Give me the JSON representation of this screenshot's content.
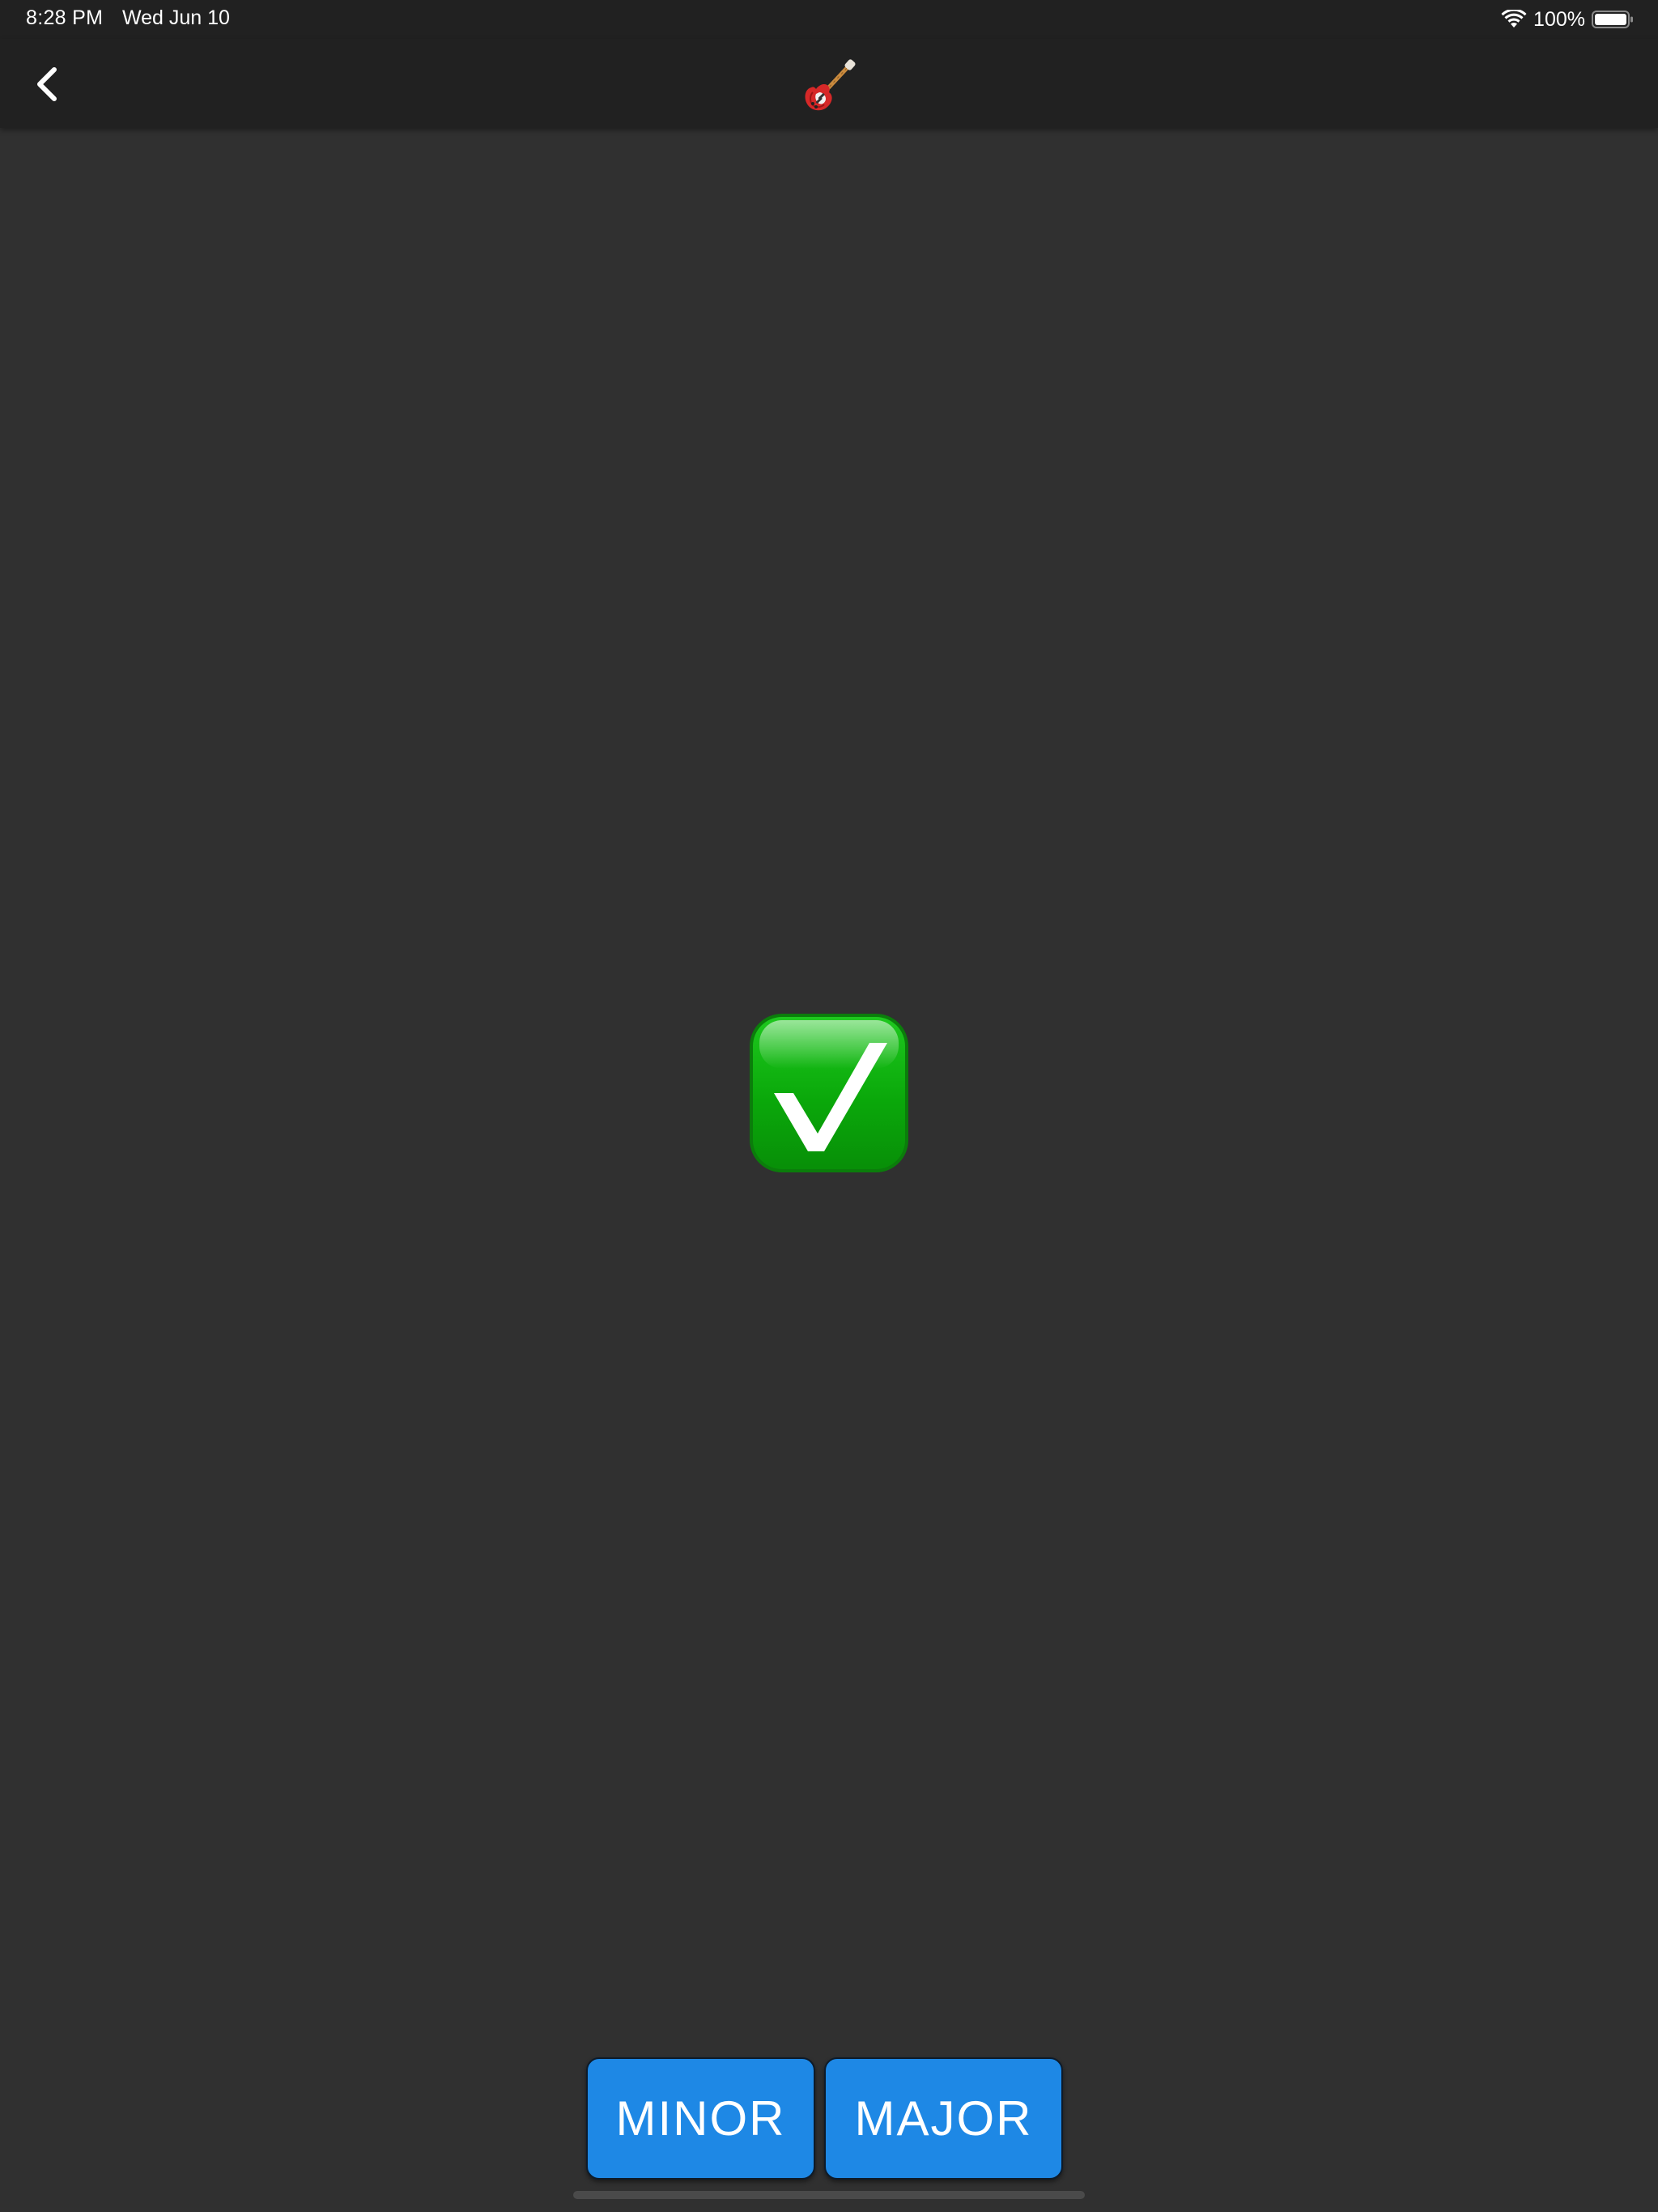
{
  "status_bar": {
    "time": "8:28 PM",
    "date": "Wed Jun 10",
    "battery_percent": "100%",
    "battery_level": 1.0,
    "icons": [
      "wifi-icon",
      "battery-icon"
    ]
  },
  "nav_bar": {
    "back_icon": "chevron-left-icon",
    "title_icon": "electric-guitar-icon"
  },
  "main": {
    "result_icon": "check-mark-button-icon"
  },
  "answers": {
    "minor_label": "MINOR",
    "major_label": "MAJOR"
  },
  "colors": {
    "background": "#303030",
    "bars": "#212121",
    "button": "#1e88e5",
    "check_green": "#10b010"
  }
}
